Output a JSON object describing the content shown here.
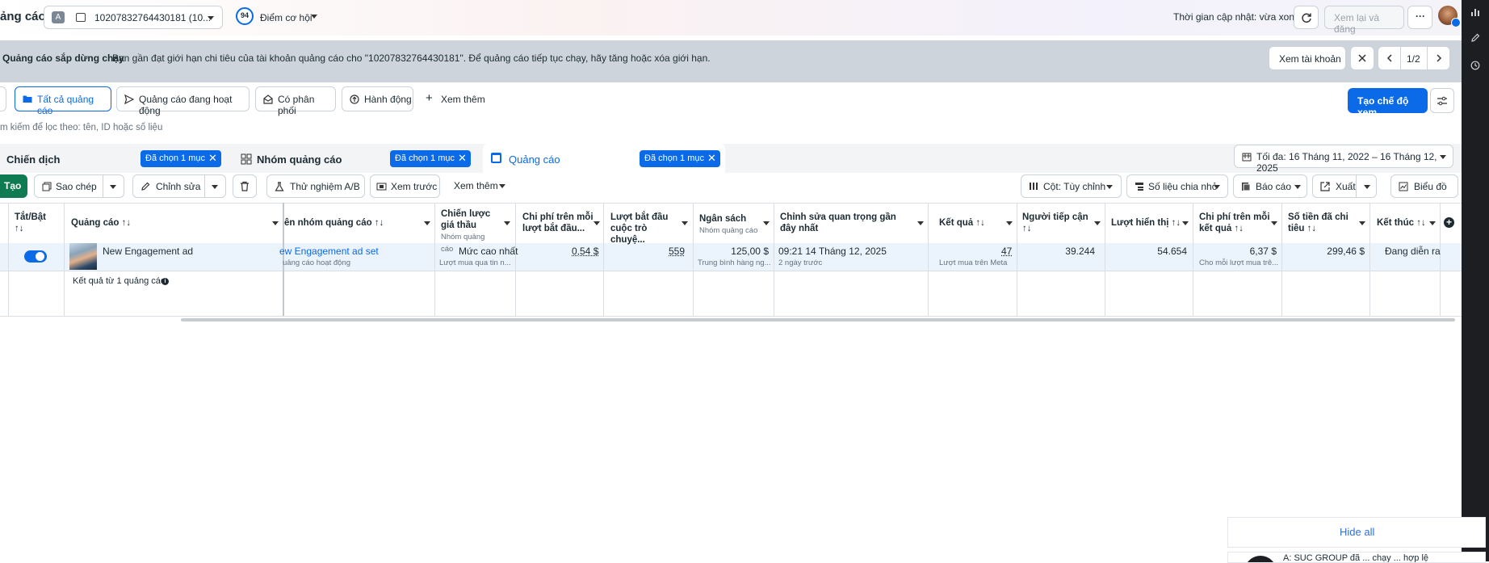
{
  "header": {
    "title": "ảng cáo",
    "account_badge": "A",
    "account_id": "10207832764430181 (10...",
    "score": "94",
    "score_label": "Điểm cơ hội",
    "updated": "Thời gian cập nhật: vừa xong",
    "review_button": "Xem lại và đăng",
    "more": "···"
  },
  "banner": {
    "title": "Quảng cáo sắp dừng chạy",
    "text": "Bạn gần đạt giới hạn chi tiêu của tài khoản quảng cáo cho \"10207832764430181\". Để quảng cáo tiếp tục chạy, hãy tăng hoặc xóa giới hạn.",
    "view_account": "Xem tài khoản",
    "pager": "1/2"
  },
  "filters": {
    "all_ads": "Tất cả quảng cáo",
    "active_ads": "Quảng cáo đang hoạt động",
    "delivery": "Có phân phối",
    "actions": "Hành động",
    "see_more": "Xem thêm",
    "create_view": "Tạo chế độ xem",
    "search_placeholder": "m kiếm để lọc theo: tên, ID hoặc số liệu"
  },
  "levels": {
    "campaign": "Chiến dịch",
    "adset": "Nhóm quảng cáo",
    "ad": "Quảng cáo",
    "selected": "Đã chọn 1 mục",
    "date_range": "Tối đa: 16 Tháng 11, 2022 – 16 Tháng 12, 2025"
  },
  "toolbar": {
    "create": "Tạo",
    "duplicate": "Sao chép",
    "edit": "Chỉnh sửa",
    "ab_test": "Thử nghiệm A/B",
    "preview": "Xem trước",
    "more": "Xem thêm",
    "columns": "Cột: Tùy chỉnh",
    "breakdown": "Số liệu chia nhỏ",
    "reports": "Báo cáo",
    "export": "Xuất",
    "charts": "Biểu đồ"
  },
  "table": {
    "headers": {
      "toggle": "Tắt/Bật",
      "ad": "Quảng cáo",
      "adset_name": "ên nhóm quảng cáo",
      "bid": "Chiến lược giá thầu",
      "bid_sub": "Nhóm quảng cáo",
      "cost_per_start": "Chi phí trên mỗi lượt bắt đầu...",
      "conv_starts": "Lượt bắt đầu cuộc trò chuyệ...",
      "budget": "Ngân sách",
      "budget_sub": "Nhóm quảng cáo",
      "last_edit": "Chỉnh sửa quan trọng gần đây nhất",
      "results": "Kết quả",
      "reach": "Người tiếp cận",
      "impressions": "Lượt hiển thị",
      "cost_per_result": "Chi phí trên mỗi kết quả",
      "spent": "Số tiền đã chi tiêu",
      "ends": "Kết thúc"
    },
    "row": {
      "ad_name": "New Engagement ad",
      "adset_name": "ew Engagement ad set",
      "adset_sub": "uảng cáo hoạt động",
      "bid": "Mức cao nhất",
      "bid_sub": "Lượt mua qua tin n...",
      "cost_per_start": "0,54 $",
      "conv_starts": "559",
      "budget": "125,00 $",
      "budget_sub": "Trung bình hàng ng...",
      "last_edit": "09:21 14 Tháng 12, 2025",
      "last_edit_sub": "2 ngày trước",
      "results": "47",
      "results_sub": "Lượt mua trên Meta",
      "reach": "39.244",
      "impressions": "54.654",
      "cost_per_result": "6,37 $",
      "cost_per_result_sub": "Cho mỗi lượt mua trê...",
      "spent": "299,46 $",
      "ends": "Đang diễn ra"
    },
    "summary": "Kết quả từ 1 quảng cáo"
  },
  "popup": {
    "hide_all": "Hide all",
    "item_text": "A: SUC GROUP đã ... chạy ... hợp lệ"
  },
  "colors": {
    "accent": "#0a6ae8",
    "banner": "#ced4db",
    "create": "#0f7b52"
  }
}
